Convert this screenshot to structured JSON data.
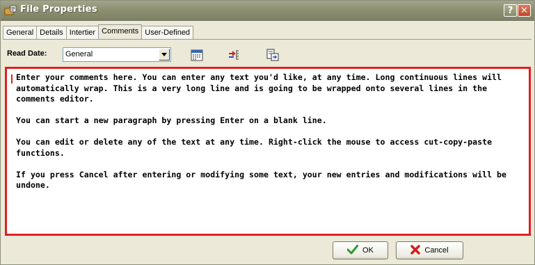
{
  "window": {
    "title": "File Properties",
    "title_icon": "folder-properties-icon",
    "help_label": "?",
    "close_label": "✕"
  },
  "tabs": [
    {
      "label": "General",
      "active": false
    },
    {
      "label": "Details",
      "active": false
    },
    {
      "label": "Intertier",
      "active": false
    },
    {
      "label": "Comments",
      "active": true
    },
    {
      "label": "User-Defined",
      "active": false
    }
  ],
  "toolbar": {
    "read_date_label": "Read Date:",
    "read_date_value": "General",
    "icons": [
      "calendar-icon",
      "insert-date-icon",
      "paste-icon"
    ]
  },
  "editor": {
    "paragraphs": [
      "Enter your comments here. You can enter any text you'd like, at any time. Long continuous lines will automatically wrap. This is a very long line and is going to be wrapped onto several lines in the comments editor.",
      "You can start a new paragraph by pressing Enter on a blank line.",
      "You can edit or delete any of the text at any time. Right-click the mouse to access cut-copy-paste functions.",
      "If you press Cancel after entering or modifying some text, your new entries and modifications will be undone."
    ]
  },
  "buttons": {
    "ok_label": "OK",
    "cancel_label": "Cancel"
  },
  "colors": {
    "title_bar": "#8e9073",
    "editor_border": "#e02020",
    "window_bg": "#ece9d8"
  }
}
